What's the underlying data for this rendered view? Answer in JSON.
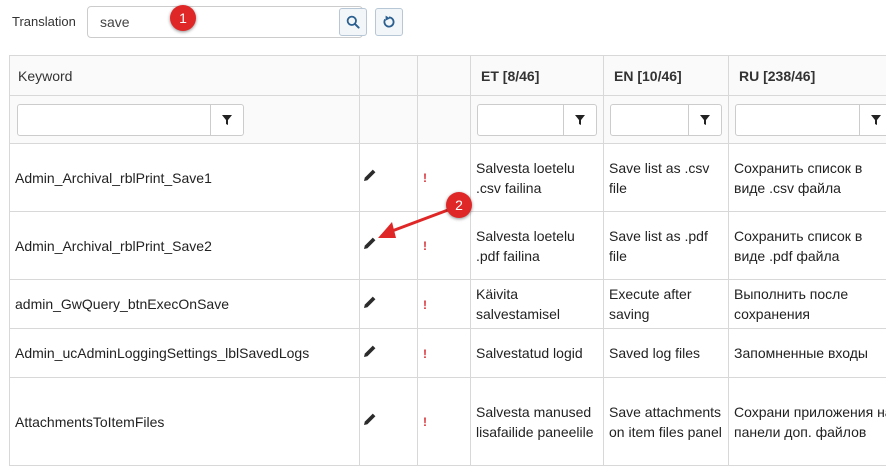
{
  "search": {
    "label": "Translation",
    "value": "save"
  },
  "markers": [
    "1",
    "2"
  ],
  "columns": {
    "keyword": "Keyword",
    "langs": [
      "ET [8/46]",
      "EN [10/46]",
      "RU [238/46]"
    ]
  },
  "rows": [
    {
      "keyword": "Admin_Archival_rblPrint_Save1",
      "et": "Salvesta loetelu .csv failina",
      "en": "Save list as .csv file",
      "ru": "Сохранить список в виде .csv файла"
    },
    {
      "keyword": "Admin_Archival_rblPrint_Save2",
      "et": "Salvesta loetelu .pdf failina",
      "en": "Save list as .pdf file",
      "ru": "Сохранить список в виде .pdf файла"
    },
    {
      "keyword": "admin_GwQuery_btnExecOnSave",
      "et": "Käivita salvestamisel",
      "en": "Execute after saving",
      "ru": "Выполнить после сохранения"
    },
    {
      "keyword": "Admin_ucAdminLoggingSettings_lblSavedLogs",
      "et": "Salvestatud logid",
      "en": "Saved log files",
      "ru": "Запомненные входы"
    },
    {
      "keyword": "AttachmentsToItemFiles",
      "et": "Salvesta manused lisafailide paneelile",
      "en": "Save attachments on item files panel",
      "ru": "Сохрани приложения на панели доп. файлов"
    }
  ],
  "row_icons": {
    "edit": "pencil-icon",
    "status": "exclamation-icon"
  },
  "colors": {
    "marker": "#e02727",
    "warning": "#d9363e",
    "border": "#d8d8d8"
  }
}
